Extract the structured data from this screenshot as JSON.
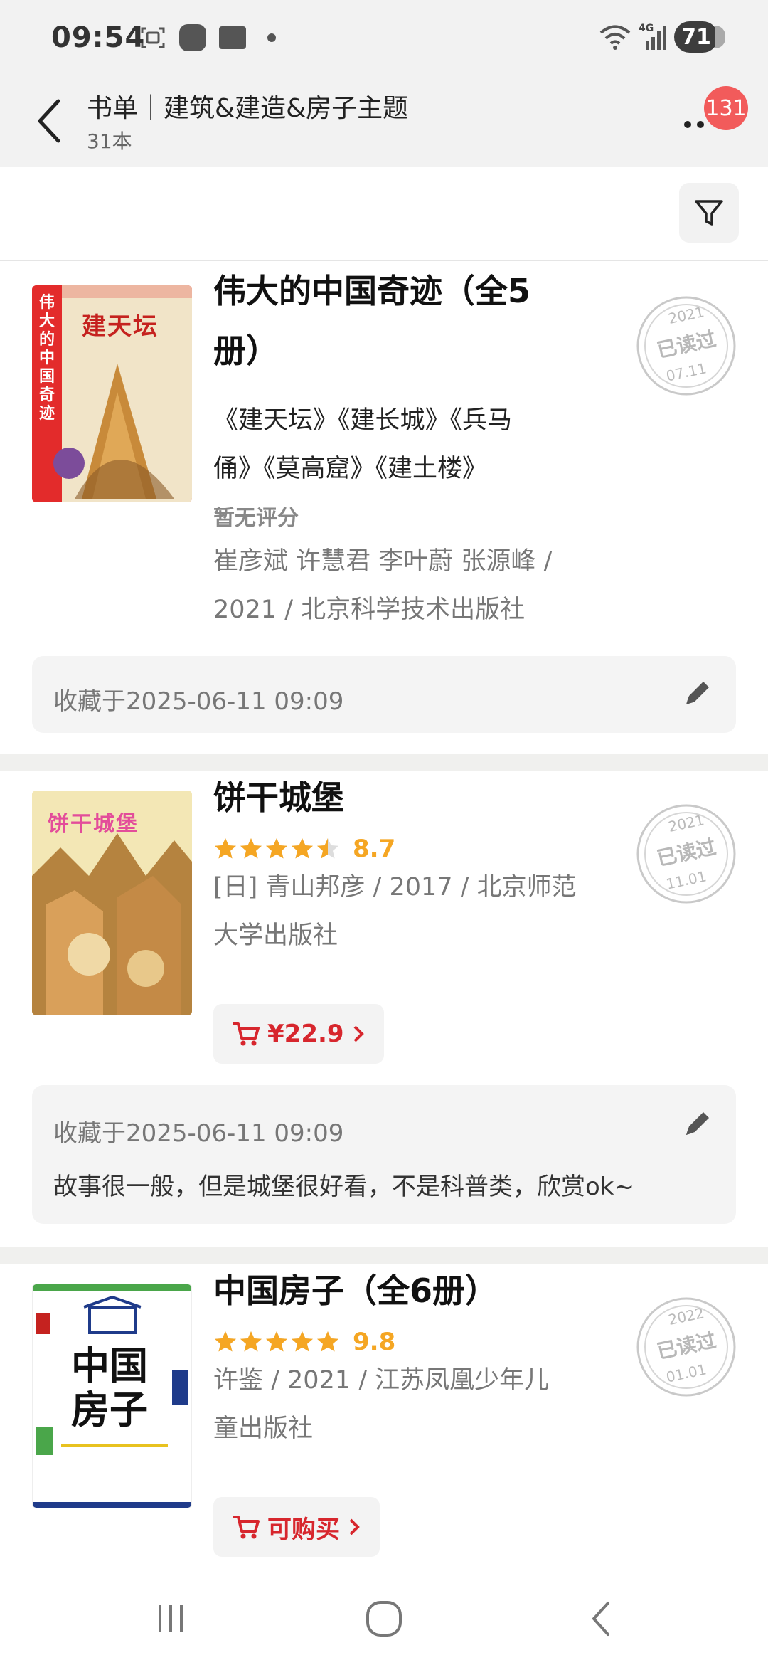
{
  "status_bar": {
    "time": "09:54",
    "network": "4G",
    "battery": "71"
  },
  "header": {
    "title": "书单｜建筑&建造&房子主题",
    "subtitle": "31本",
    "badge_count": "131"
  },
  "icons": {
    "back": "back-arrow-icon",
    "more": "more-dots-icon",
    "filter": "filter-funnel-icon",
    "edit": "pencil-icon",
    "cart": "cart-icon",
    "stamp": "read-stamp-icon"
  },
  "colors": {
    "star": "#f5a623",
    "buy_red": "#d7262d",
    "badge_red": "#f25b5b"
  },
  "books": [
    {
      "title_line1": "伟大的中国奇迹（全5",
      "title_line2": "册）",
      "sub_line1": "《建天坛》《建长城》《兵马",
      "sub_line2": "俑》《莫高窟》《建土楼》",
      "rating_text": "暂无评分",
      "meta_line1": "崔彦斌 许慧君 李叶蔚 张源峰 /",
      "meta_line2": "2021 / 北京科学技术出版社",
      "stamp": {
        "year": "2021",
        "label": "已读过",
        "date": "07.11"
      },
      "cover": {
        "title": "建天坛",
        "series": "伟大的中国奇迹"
      },
      "note_date": "收藏于2025-06-11 09:09"
    },
    {
      "title_line1": "饼干城堡",
      "stars": 4.5,
      "score": "8.7",
      "meta_line1": "[日] 青山邦彦 / 2017 / 北京师范",
      "meta_line2": "大学出版社",
      "price": "¥22.9",
      "stamp": {
        "year": "2021",
        "label": "已读过",
        "date": "11.01"
      },
      "cover": {
        "title": "饼干城堡"
      },
      "note_date": "收藏于2025-06-11 09:09",
      "note_text": "故事很一般，但是城堡很好看，不是科普类，欣赏ok~"
    },
    {
      "title_line1": "中国房子（全6册）",
      "stars": 5,
      "score": "9.8",
      "meta_line1": "许鉴 / 2021 / 江苏凤凰少年儿",
      "meta_line2": "童出版社",
      "buy_label": "可购买",
      "stamp": {
        "year": "2022",
        "label": "已读过",
        "date": "01.01"
      },
      "cover": {
        "title_line1": "中国",
        "title_line2": "房子"
      }
    }
  ]
}
